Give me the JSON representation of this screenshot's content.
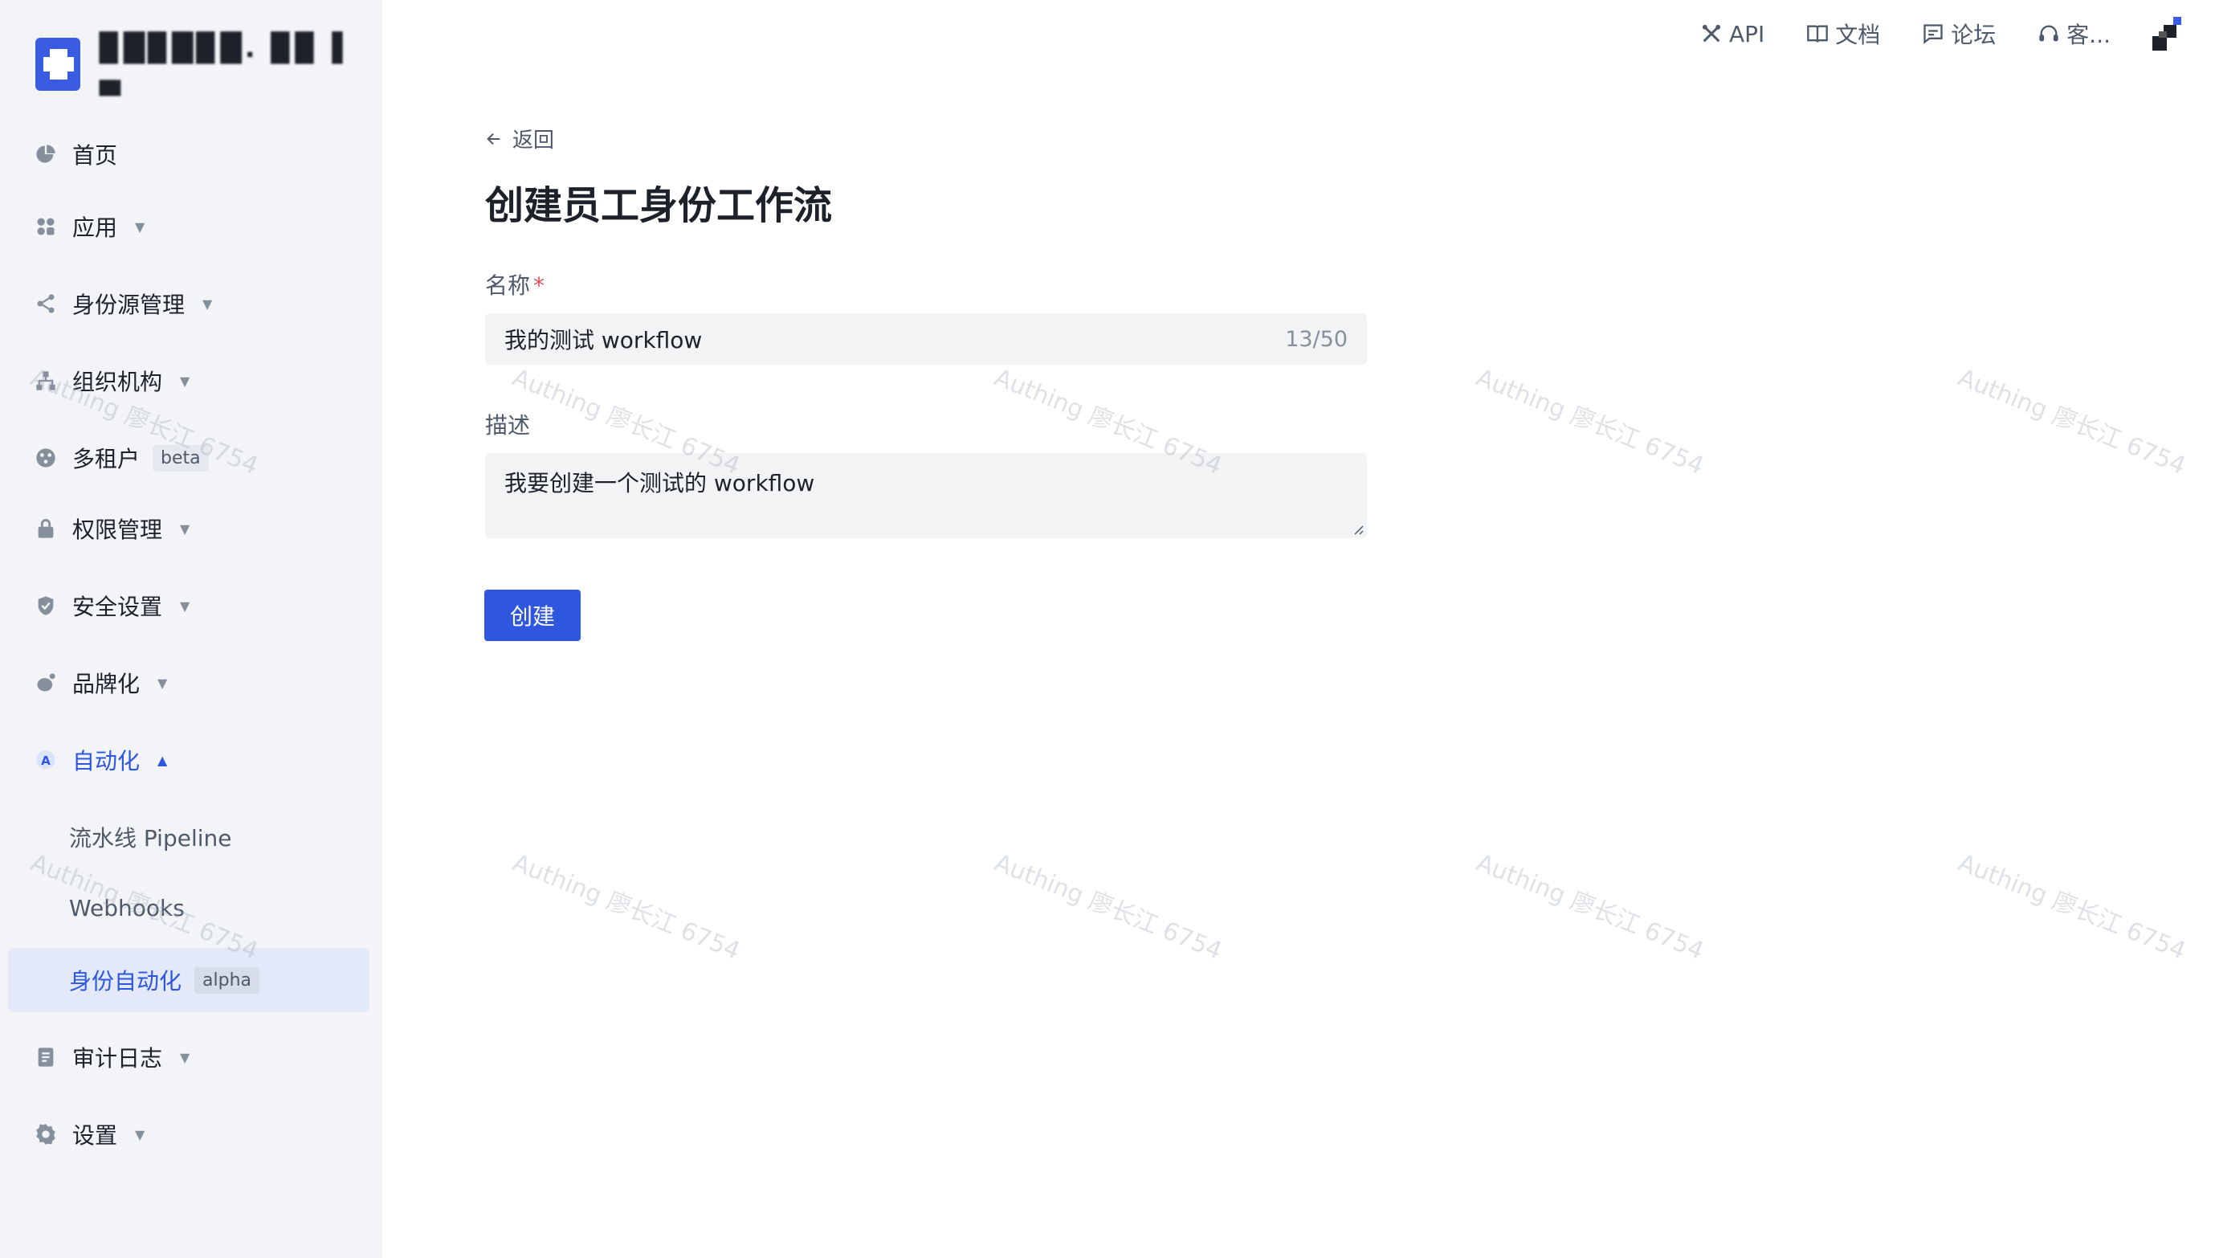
{
  "sidebar": {
    "logo_text": "▉█▉█▉█. ▉▉ ▌ ▄",
    "items": [
      {
        "label": "首页",
        "icon": "pie-chart-icon"
      },
      {
        "label": "应用",
        "icon": "apps-icon"
      },
      {
        "label": "身份源管理",
        "icon": "share-icon"
      },
      {
        "label": "组织机构",
        "icon": "org-tree-icon"
      },
      {
        "label": "多租户",
        "icon": "tenant-icon",
        "tag": "beta"
      },
      {
        "label": "权限管理",
        "icon": "lock-icon"
      },
      {
        "label": "安全设置",
        "icon": "shield-icon"
      },
      {
        "label": "品牌化",
        "icon": "brand-icon"
      },
      {
        "label": "自动化",
        "icon": "automation-icon"
      },
      {
        "label": "审计日志",
        "icon": "audit-log-icon"
      },
      {
        "label": "设置",
        "icon": "gear-icon"
      }
    ],
    "sub_items": [
      {
        "label": "流水线 Pipeline"
      },
      {
        "label": "Webhooks"
      },
      {
        "label": "身份自动化",
        "tag": "alpha"
      }
    ]
  },
  "topbar": {
    "api": "API",
    "docs": "文档",
    "forum": "论坛",
    "support": "客..."
  },
  "main": {
    "back_label": "返回",
    "title": "创建员工身份工作流",
    "name_label": "名称",
    "name_required": "*",
    "name_value": "我的测试 workflow",
    "name_count": "13/50",
    "desc_label": "描述",
    "desc_value": "我要创建一个测试的 workflow",
    "create_button": "创建"
  },
  "watermark": "Authing 廖长江 6754",
  "colors": {
    "accent": "#2f56df",
    "sidebar_bg": "#f2f4f7",
    "input_bg": "#f2f3f5",
    "required": "#e34d59"
  }
}
